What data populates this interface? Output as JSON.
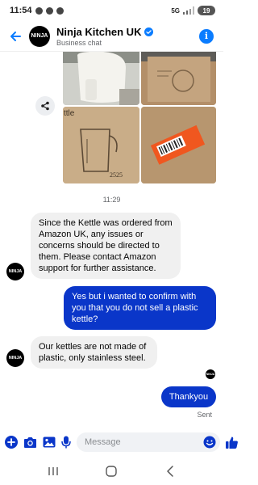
{
  "status_bar": {
    "time": "11:54",
    "network": "5G",
    "battery": "19"
  },
  "header": {
    "title": "Ninja Kitchen UK",
    "subtitle": "Business chat",
    "avatar_text": "NINJA",
    "icons": [
      "back-arrow-icon",
      "verified-badge-icon",
      "info-icon"
    ]
  },
  "photos": {
    "box_label": "ttle",
    "box_number": "2525"
  },
  "timestamp": "11:29",
  "messages": [
    {
      "from": "business",
      "text": "Since the Kettle was ordered from Amazon UK, any issues or concerns should be directed to them. Please contact Amazon support for further assistance."
    },
    {
      "from": "user",
      "text": "Yes but i wanted to confirm with you that you do not sell a plastic kettle?"
    },
    {
      "from": "business",
      "text": "Our kettles are not made of plastic, only stainless steel."
    },
    {
      "from": "user",
      "text": "Thankyou"
    }
  ],
  "sent_label": "Sent",
  "composer": {
    "placeholder": "Message",
    "icons": [
      "plus-icon",
      "camera-icon",
      "gallery-icon",
      "microphone-icon",
      "emoji-icon",
      "thumbs-up-icon"
    ]
  },
  "colors": {
    "accent": "#0a7cff",
    "outgoing_bubble": "#0a36c9",
    "incoming_bubble": "#f0f0f0"
  }
}
